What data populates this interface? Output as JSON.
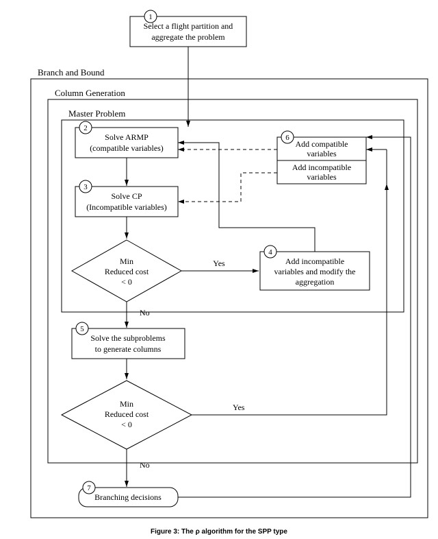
{
  "nodes": {
    "n1_l1": "Select a flight partition and",
    "n1_l2": "aggregate the problem",
    "n2_l1": "Solve ARMP",
    "n2_l2": "(compatible variables)",
    "n3_l1": "Solve CP",
    "n3_l2": "(Incompatible variables)",
    "d1_l1": "Min",
    "d1_l2": "Reduced cost",
    "d1_l3": "< 0",
    "n4_l1": "Add incompatible",
    "n4_l2": "variables and modify the",
    "n4_l3": "aggregation",
    "n5_l1": "Solve the subproblems",
    "n5_l2": "to generate columns",
    "d2_l1": "Min",
    "d2_l2": "Reduced cost",
    "d2_l3": "< 0",
    "n6a_l1": "Add compatible",
    "n6a_l2": "variables",
    "n6b_l1": "Add incompatible",
    "n6b_l2": "variables",
    "n7": "Branching decisions"
  },
  "labels": {
    "bnb": "Branch and Bound",
    "cg": "Column Generation",
    "mp": "Master Problem",
    "yes": "Yes",
    "no": "No"
  },
  "caption": "Figure 3: The ρ algorithm for the SPP type",
  "numbers": {
    "n1": "1",
    "n2": "2",
    "n3": "3",
    "n4": "4",
    "n5": "5",
    "n6": "6",
    "n7": "7"
  }
}
